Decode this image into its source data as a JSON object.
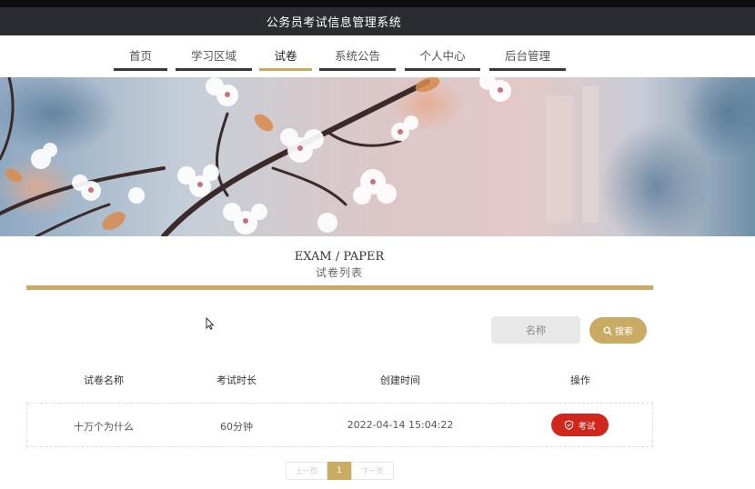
{
  "header": {
    "title": "公务员考试信息管理系统"
  },
  "nav": {
    "items": [
      {
        "label": "首页"
      },
      {
        "label": "学习区域"
      },
      {
        "label": "试卷",
        "active": true
      },
      {
        "label": "系统公告"
      },
      {
        "label": "个人中心"
      },
      {
        "label": "后台管理"
      }
    ]
  },
  "section": {
    "title_en": "EXAM / PAPER",
    "title_cn": "试卷列表"
  },
  "search": {
    "placeholder": "名称",
    "button_label": "搜索"
  },
  "table": {
    "columns": [
      "试卷名称",
      "考试时长",
      "创建时间",
      "操作"
    ],
    "rows": [
      {
        "name": "十万个为什么",
        "duration": "60分钟",
        "created": "2022-04-14 15:04:22",
        "action": "考试"
      }
    ]
  },
  "pagination": {
    "prev": "上一页",
    "current": "1",
    "next": "下一页"
  },
  "colors": {
    "accent_gold": "#c9ab63",
    "exam_button": "#d1261c",
    "header_bg": "#2b2c31"
  },
  "icons": {
    "search": "search-icon",
    "exam": "shield-check-icon",
    "cursor": "mouse-cursor-icon"
  }
}
